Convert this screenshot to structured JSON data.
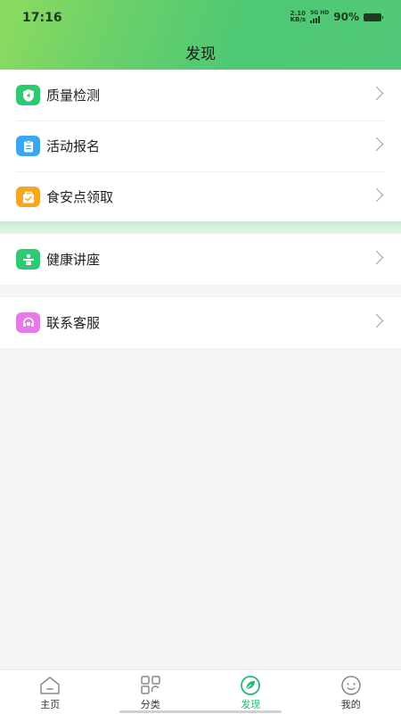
{
  "status_bar": {
    "time": "17:16",
    "net_speed_value": "2.10",
    "net_speed_unit": "KB/s",
    "net_type": "5G HD",
    "battery_percent": "90%",
    "battery_level": 0.9
  },
  "header": {
    "title": "发现"
  },
  "groups": [
    {
      "items": [
        {
          "label": "质量检测",
          "icon": "shield-bolt-icon",
          "color": "#2ec973"
        },
        {
          "label": "活动报名",
          "icon": "clipboard-icon",
          "color": "#3aa8f0"
        },
        {
          "label": "食安点领取",
          "icon": "gift-box-icon",
          "color": "#f5a623"
        }
      ]
    },
    {
      "items": [
        {
          "label": "健康讲座",
          "icon": "lecture-icon",
          "color": "#2ec973"
        }
      ]
    },
    {
      "items": [
        {
          "label": "联系客服",
          "icon": "customer-service-icon",
          "color": "#e879e8"
        }
      ]
    }
  ],
  "tabbar": {
    "tabs": [
      {
        "label": "主页",
        "icon": "home-icon",
        "active": false
      },
      {
        "label": "分类",
        "icon": "category-icon",
        "active": false
      },
      {
        "label": "发现",
        "icon": "discover-leaf-icon",
        "active": true
      },
      {
        "label": "我的",
        "icon": "smiley-icon",
        "active": false
      }
    ],
    "active_color": "#2bb673"
  }
}
